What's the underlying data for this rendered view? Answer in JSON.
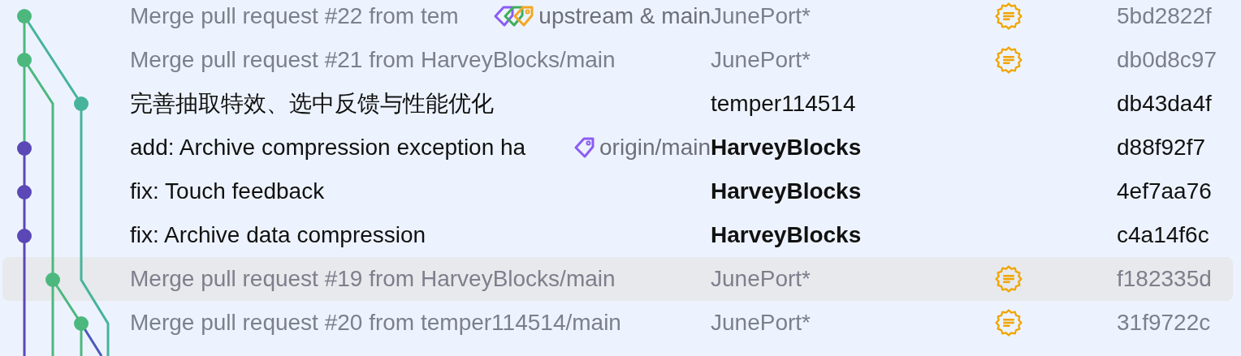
{
  "commits": [
    {
      "message": "Merge pull request #22 from tem",
      "tags": [
        {
          "label": "upstream & main",
          "icons": [
            {
              "color": "#8b5cf6"
            },
            {
              "color": "#3fae5a"
            },
            {
              "color": "#f5a623"
            }
          ]
        }
      ],
      "author": "JunePort*",
      "author_bold": false,
      "merge": true,
      "hash": "5bd2822f",
      "selected": false
    },
    {
      "message": "Merge pull request #21 from HarveyBlocks/main",
      "author": "JunePort*",
      "author_bold": false,
      "merge": true,
      "hash": "db0d8c97",
      "selected": false
    },
    {
      "message": "完善抽取特效、选中反馈与性能优化",
      "author": "temper114514",
      "author_bold": false,
      "merge": false,
      "hash": "db43da4f",
      "selected": false
    },
    {
      "message": "add: Archive compression exception ha",
      "tags": [
        {
          "label": "origin/main",
          "icons": [
            {
              "color": "#8b5cf6"
            }
          ]
        }
      ],
      "author": "HarveyBlocks",
      "author_bold": true,
      "merge": false,
      "hash": "d88f92f7",
      "selected": false
    },
    {
      "message": "fix: Touch feedback",
      "author": "HarveyBlocks",
      "author_bold": true,
      "merge": false,
      "hash": "4ef7aa76",
      "selected": false
    },
    {
      "message": "fix: Archive data compression",
      "author": "HarveyBlocks",
      "author_bold": true,
      "merge": false,
      "hash": "c4a14f6c",
      "selected": false
    },
    {
      "message": "Merge pull request #19 from HarveyBlocks/main",
      "author": "JunePort*",
      "author_bold": false,
      "merge": true,
      "hash": "f182335d",
      "selected": true
    },
    {
      "message": "Merge pull request #20 from temper114514/main",
      "author": "JunePort*",
      "author_bold": false,
      "merge": true,
      "hash": "31f9722c",
      "selected": false
    }
  ]
}
